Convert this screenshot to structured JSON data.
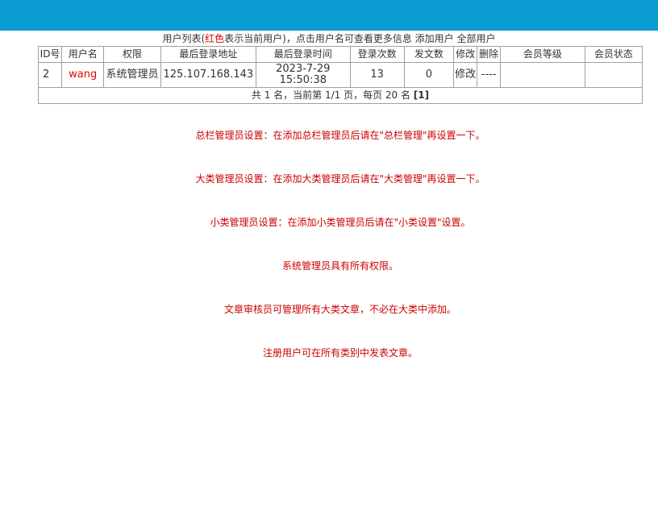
{
  "header": {
    "prefix": "用户列表(",
    "red_word": "红色",
    "suffix": "表示当前用户)，点击用户名可查看更多信息",
    "link_add": "添加用户",
    "link_all": "全部用户",
    "bar_color": "#0a9bd1"
  },
  "table": {
    "columns": [
      "ID号",
      "用户名",
      "权限",
      "最后登录地址",
      "最后登录时间",
      "登录次数",
      "发文数",
      "修改",
      "删除",
      "会员等级",
      "会员状态"
    ],
    "row": {
      "id": "2",
      "username": "wang",
      "role": "系统管理员",
      "ip": "125.107.168.143",
      "date": "2023-7-29",
      "time": "15:50:38",
      "logins": "13",
      "posts": "0",
      "edit": "修改",
      "delete": "----",
      "level": "",
      "status": ""
    },
    "pager": {
      "text": "共 1 名，当前第 1/1 页，每页 20 名 ",
      "page": "[1]"
    }
  },
  "notes": [
    "总栏管理员设置：在添加总栏管理员后请在\"总栏管理\"再设置一下。",
    "大类管理员设置：在添加大类管理员后请在\"大类管理\"再设置一下。",
    "小类管理员设置：在添加小类管理员后请在\"小类设置\"设置。",
    "系统管理员具有所有权限。",
    "文章审核员可管理所有大类文章，不必在大类中添加。",
    "注册用户可在所有类别中发表文章。"
  ]
}
